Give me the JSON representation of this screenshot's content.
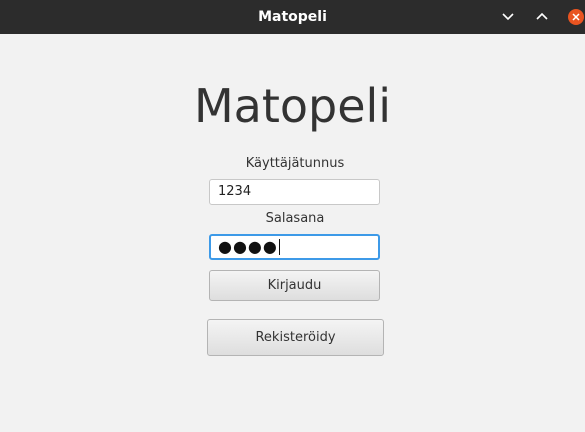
{
  "window": {
    "title": "Matopeli",
    "controls": {
      "minimize_icon": "chevron-down-icon",
      "maximize_icon": "chevron-up-icon",
      "close_icon": "close-icon",
      "close_color": "#e95420"
    }
  },
  "app": {
    "heading": "Matopeli"
  },
  "login_form": {
    "username_label": "Käyttäjätunnus",
    "username_value": "1234",
    "password_label": "Salasana",
    "password_masked": "●●●●",
    "focus_color": "#3d9ae8",
    "login_button": "Kirjaudu",
    "register_button": "Rekisteröidy"
  }
}
